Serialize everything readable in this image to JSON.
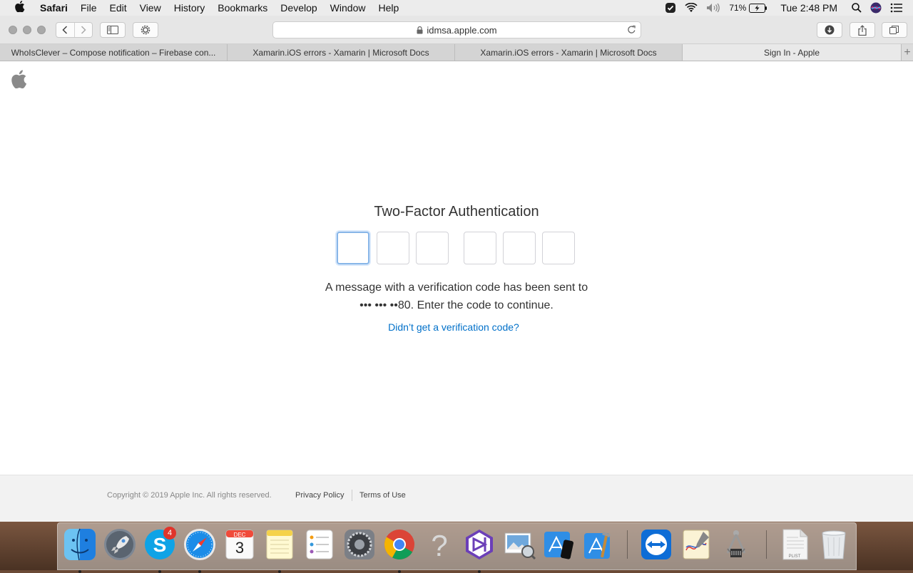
{
  "menubar": {
    "app_name": "Safari",
    "items": [
      "File",
      "Edit",
      "View",
      "History",
      "Bookmarks",
      "Develop",
      "Window",
      "Help"
    ],
    "battery": "71%",
    "clock": "Tue 2:48 PM"
  },
  "browser": {
    "url": "idmsa.apple.com",
    "tabs": [
      {
        "title": "WhoIsClever – Compose notification – Firebase con..."
      },
      {
        "title": "Xamarin.iOS errors - Xamarin | Microsoft Docs"
      },
      {
        "title": "Xamarin.iOS errors - Xamarin | Microsoft Docs"
      },
      {
        "title": "Sign In - Apple"
      }
    ],
    "new_tab": "+"
  },
  "page": {
    "title": "Two-Factor Authentication",
    "message_line1": "A message with a verification code has been sent to",
    "message_line2": "••• ••• ••80. Enter the code to continue.",
    "resend_link": "Didn’t get a verification code?"
  },
  "footer": {
    "copyright": "Copyright © 2019 Apple Inc. All rights reserved.",
    "privacy": "Privacy Policy",
    "terms": "Terms of Use"
  },
  "dock": {
    "skype_badge": "4",
    "calendar_month": "DEC",
    "calendar_day": "3",
    "plist_label": "PLIST",
    "apps": [
      "finder-icon",
      "launchpad-icon",
      "skype-icon",
      "safari-icon",
      "calendar-icon",
      "notes-icon",
      "reminders-icon",
      "system-preferences-icon",
      "chrome-icon",
      "help-icon",
      "visual-studio-icon",
      "preview-icon",
      "simulator-icon",
      "xcode-icon",
      "teamviewer-icon",
      "grapher-icon",
      "instruments-icon",
      "plist-file-icon",
      "trash-icon"
    ]
  },
  "colors": {
    "link": "#0070c9",
    "focus": "#88b6e8"
  }
}
